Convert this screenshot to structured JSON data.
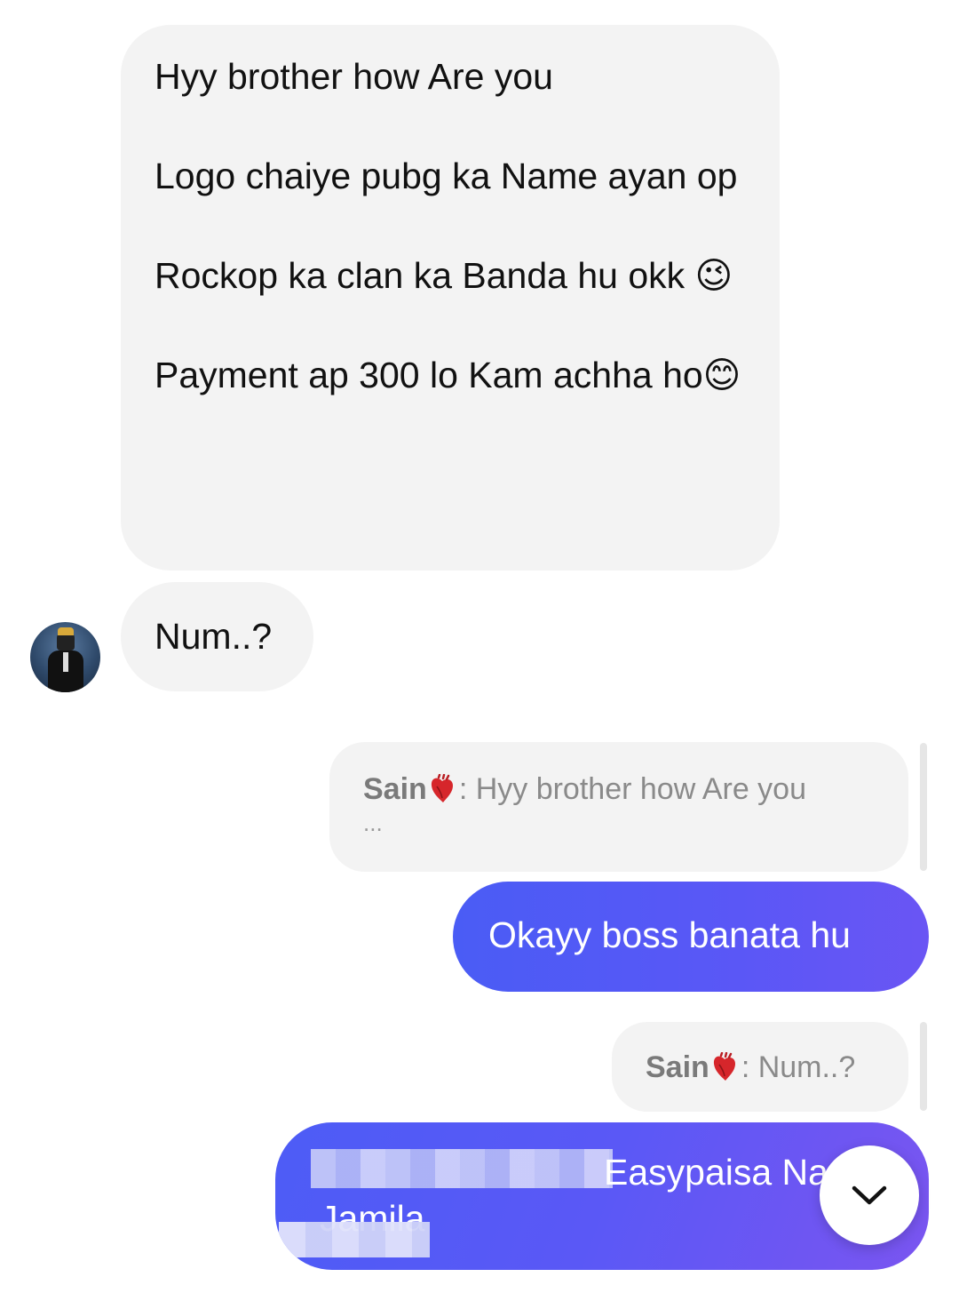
{
  "incoming": {
    "message1": {
      "para1": "Hyy brother how Are you",
      "para2": "Logo chaiye pubg ka Name ayan op",
      "para3": "Rockop ka clan ka Banda hu okk 😉",
      "para4": "Payment ap 300 lo Kam achha ho😊"
    },
    "message2": "Num..?"
  },
  "replies": [
    {
      "name": "Sain",
      "text": ": Hyy brother how Are you",
      "more": "..."
    },
    {
      "name": "Sain",
      "text": ": Num..?"
    }
  ],
  "outgoing": {
    "message1": "Okayy boss banata hu",
    "message2_line1": "Easypaisa Na",
    "message2_line2": "Jamila"
  },
  "icons": {
    "avatar": "user-avatar",
    "reply_heart": "anatomical-heart-icon",
    "scroll_down": "chevron-down-icon"
  },
  "colors": {
    "incoming_bubble": "#f3f3f3",
    "outgoing_bubble_start": "#4a5cf5",
    "outgoing_bubble_end": "#7a55f0"
  }
}
